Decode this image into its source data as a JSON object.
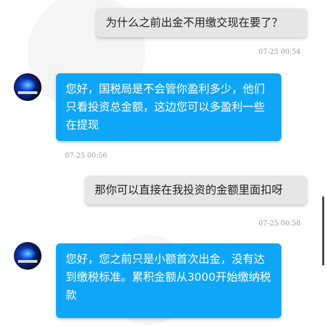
{
  "messages": [
    {
      "side": "sent",
      "text": "为什么之前出金不用缴交现在要了？",
      "time": "07-25 00:54"
    },
    {
      "side": "recv",
      "text": "您好，国税局是不会管你盈利多少，他们只看投资总金额，这边您可以多盈利一些在提现",
      "time": "07-25 00:56"
    },
    {
      "side": "sent",
      "text": "那你可以直接在我投资的金额里面扣呀",
      "time": "07-25 00:58"
    },
    {
      "side": "recv",
      "text": "您好，您之前只是小额首次出金，没有达到缴税标准。累积金额从3000开始缴纳税款"
    }
  ],
  "colors": {
    "sent_bubble": "#e6e6e6",
    "recv_bubble": "#10a6f8"
  }
}
